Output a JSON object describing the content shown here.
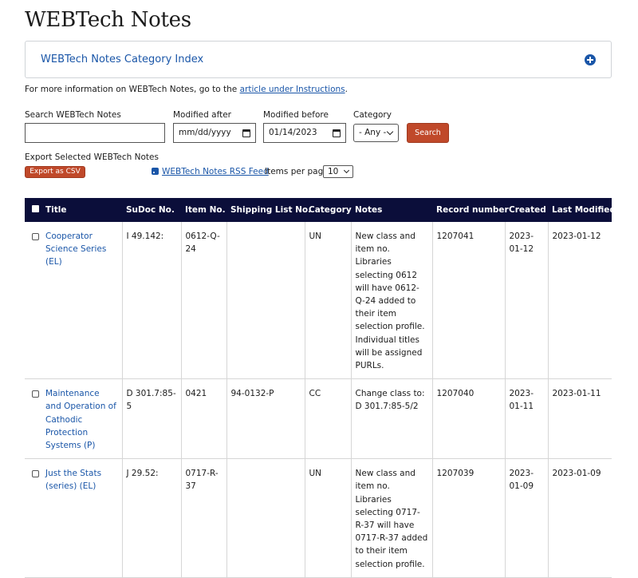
{
  "page_title": "WEBTech Notes",
  "accordion": {
    "title": "WEBTech Notes Category Index",
    "icon": "plus-circle-icon"
  },
  "info": {
    "prefix": "For more information on WEBTech Notes, go to the ",
    "link": "article under Instructions",
    "suffix": "."
  },
  "filters": {
    "search_label": "Search WEBTech Notes",
    "search_value": "",
    "modified_after_label": "Modified after",
    "modified_after_value": "mm/dd/yyyy",
    "modified_before_label": "Modified before",
    "modified_before_value": "01/14/2023",
    "category_label": "Category",
    "category_value": "- Any -",
    "search_button": "Search"
  },
  "export": {
    "label": "Export Selected WEBTech Notes",
    "csv_button": "Export as CSV"
  },
  "rss": {
    "label": "WEBTech Notes RSS Feed",
    "icon": "rss-icon"
  },
  "items_per_page": {
    "label": "Items per page",
    "value": "10"
  },
  "table": {
    "headers": [
      "Title",
      "SuDoc No.",
      "Item No.",
      "Shipping List No.",
      "Category",
      "Notes",
      "Record number",
      "Created",
      "Last Modified"
    ],
    "rows": [
      {
        "title": "Cooperator Science Series (EL)",
        "sudoc": "I 49.142:",
        "item": "0612-Q-24",
        "shipping": "",
        "category": "UN",
        "notes": "New class and item no. Libraries selecting 0612 will have 0612-Q-24 added to their item selection profile. Individual titles will be assigned PURLs.",
        "record": "1207041",
        "created": "2023-01-12",
        "modified": "2023-01-12"
      },
      {
        "title": "Maintenance and Operation of Cathodic Protection Systems (P)",
        "sudoc": "D 301.7:85-5",
        "item": "0421",
        "shipping": "94-0132-P",
        "category": "CC",
        "notes": "Change class to: D 301.7:85-5/2",
        "record": "1207040",
        "created": "2023-01-11",
        "modified": "2023-01-11"
      },
      {
        "title": "Just the Stats (series) (EL)",
        "sudoc": "J 29.52:",
        "item": "0717-R-37",
        "shipping": "",
        "category": "UN",
        "notes": "New class and item no. Libraries selecting 0717-R-37 will have 0717-R-37 added to their item selection profile.",
        "record": "1207039",
        "created": "2023-01-09",
        "modified": "2023-01-09"
      }
    ]
  },
  "colors": {
    "link": "#1a56a8",
    "header_bg": "#0b0e3a",
    "button": "#c0492a"
  }
}
